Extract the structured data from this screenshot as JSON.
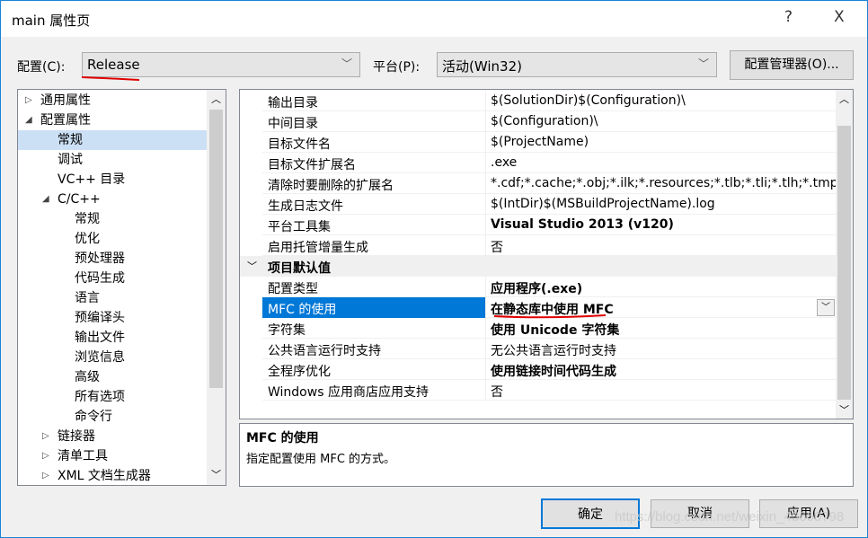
{
  "window": {
    "title": "main 属性页",
    "help": "?",
    "close": "X"
  },
  "config": {
    "label": "配置(C):",
    "value": "Release",
    "platform_label": "平台(P):",
    "platform_value": "活动(Win32)",
    "manager_button": "配置管理器(O)..."
  },
  "tree": [
    {
      "label": "通用属性",
      "level": 0,
      "arrow": "▷"
    },
    {
      "label": "配置属性",
      "level": 0,
      "arrow": "◢"
    },
    {
      "label": "常规",
      "level": 1,
      "selected": true
    },
    {
      "label": "调试",
      "level": 1
    },
    {
      "label": "VC++ 目录",
      "level": 1
    },
    {
      "label": "C/C++",
      "level": 1,
      "arrow": "◢"
    },
    {
      "label": "常规",
      "level": 2
    },
    {
      "label": "优化",
      "level": 2
    },
    {
      "label": "预处理器",
      "level": 2
    },
    {
      "label": "代码生成",
      "level": 2
    },
    {
      "label": "语言",
      "level": 2
    },
    {
      "label": "预编译头",
      "level": 2
    },
    {
      "label": "输出文件",
      "level": 2
    },
    {
      "label": "浏览信息",
      "level": 2
    },
    {
      "label": "高级",
      "level": 2
    },
    {
      "label": "所有选项",
      "level": 2
    },
    {
      "label": "命令行",
      "level": 2
    },
    {
      "label": "链接器",
      "level": 1,
      "arrow": "▷"
    },
    {
      "label": "清单工具",
      "level": 1,
      "arrow": "▷"
    },
    {
      "label": "XML 文档生成器",
      "level": 1,
      "arrow": "▷"
    }
  ],
  "grid": {
    "rows1": [
      {
        "k": "输出目录",
        "v": "$(SolutionDir)$(Configuration)\\"
      },
      {
        "k": "中间目录",
        "v": "$(Configuration)\\"
      },
      {
        "k": "目标文件名",
        "v": "$(ProjectName)"
      },
      {
        "k": "目标文件扩展名",
        "v": ".exe"
      },
      {
        "k": "清除时要删除的扩展名",
        "v": "*.cdf;*.cache;*.obj;*.ilk;*.resources;*.tlb;*.tli;*.tlh;*.tmp;*.rsp;*.pgc"
      },
      {
        "k": "生成日志文件",
        "v": "$(IntDir)$(MSBuildProjectName).log"
      },
      {
        "k": "平台工具集",
        "v": "Visual Studio 2013 (v120)",
        "bold": true
      },
      {
        "k": "启用托管增量生成",
        "v": "否"
      }
    ],
    "category": "项目默认值",
    "rows2": [
      {
        "k": "配置类型",
        "v": "应用程序(.exe)",
        "bold": true
      },
      {
        "k": "MFC 的使用",
        "v": "在静态库中使用 MFC",
        "bold": true,
        "selected": true
      },
      {
        "k": "字符集",
        "v": "使用 Unicode 字符集",
        "bold": true
      },
      {
        "k": "公共语言运行时支持",
        "v": "无公共语言运行时支持"
      },
      {
        "k": "全程序优化",
        "v": "使用链接时间代码生成",
        "bold": true
      },
      {
        "k": "Windows 应用商店应用支持",
        "v": "否"
      }
    ]
  },
  "description": {
    "title": "MFC 的使用",
    "text": "指定配置使用 MFC 的方式。"
  },
  "buttons": {
    "ok": "确定",
    "cancel": "取消",
    "apply": "应用(A)"
  },
  "watermark": "https://blog.csdn.net/weixin_43660798",
  "colors": {
    "selection": "#0078d7",
    "accent_border": "#0078d7",
    "annotation": "#e00000"
  }
}
